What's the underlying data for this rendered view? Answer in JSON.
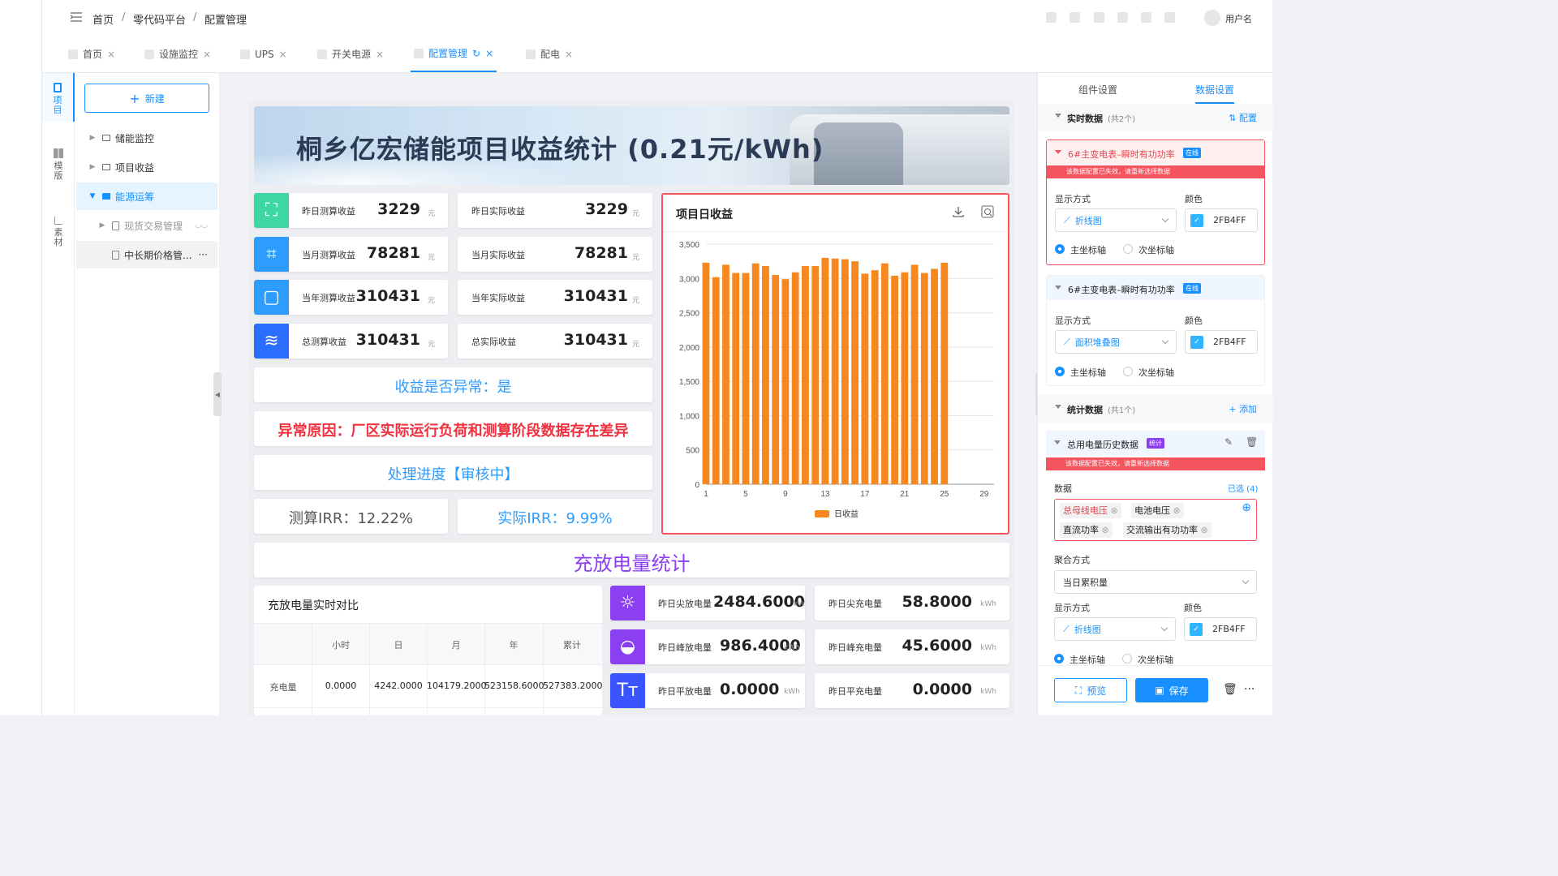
{
  "header": {
    "breadcrumb": [
      "首页",
      "零代码平台",
      "配置管理"
    ],
    "separator": "/",
    "user": "用户名"
  },
  "tabs": [
    {
      "label": "首页"
    },
    {
      "label": "设施监控"
    },
    {
      "label": "UPS"
    },
    {
      "label": "开关电源"
    },
    {
      "label": "配置管理",
      "active": true
    },
    {
      "label": "配电"
    }
  ],
  "rail": {
    "project": "项目",
    "template": "模版",
    "material": "素材"
  },
  "tree": {
    "new_label": "新建",
    "items": [
      "储能监控",
      "项目收益",
      "能源运筹",
      "现货交易管理",
      "中长期价格管..."
    ],
    "more": "···"
  },
  "banner": {
    "title": "桐乡亿宏储能项目收益统计 (0.21元/kWh)"
  },
  "kpis": [
    {
      "label": "昨日测算收益",
      "value": "3229",
      "unit": "元",
      "icon": "expand-icon",
      "color": "#3ed6a3"
    },
    {
      "label": "昨日实际收益",
      "value": "3229",
      "unit": "元"
    },
    {
      "label": "当月测算收益",
      "value": "78281",
      "unit": "元",
      "icon": "crop-icon",
      "color": "#2d9cff"
    },
    {
      "label": "当月实际收益",
      "value": "78281",
      "unit": "元"
    },
    {
      "label": "当年测算收益",
      "value": "310431",
      "unit": "元",
      "icon": "square-icon",
      "color": "#2d9cff"
    },
    {
      "label": "当年实际收益",
      "value": "310431",
      "unit": "元"
    },
    {
      "label": "总测算收益",
      "value": "310431",
      "unit": "元",
      "icon": "waves-icon",
      "color": "#2a6dff"
    },
    {
      "label": "总实际收益",
      "value": "310431",
      "unit": "元"
    }
  ],
  "status": {
    "abnormal": "收益是否异常：是",
    "reason": "异常原因：厂区实际运行负荷和测算阶段数据存在差异",
    "progress": "处理进度【审核中】",
    "irr_calc": "测算IRR：12.22%",
    "irr_actual": "实际IRR：9.99%"
  },
  "charge_title": "充放电量统计",
  "chart_data": {
    "type": "bar",
    "title": "项目日收益",
    "series": [
      {
        "name": "日收益",
        "values": [
          3230,
          3020,
          3200,
          3080,
          3080,
          3220,
          3180,
          3050,
          2990,
          3090,
          3180,
          3180,
          3300,
          3290,
          3280,
          3250,
          3070,
          3120,
          3220,
          3040,
          3090,
          3200,
          3080,
          3140,
          3230
        ]
      }
    ],
    "x": [
      1,
      2,
      3,
      4,
      5,
      6,
      7,
      8,
      9,
      10,
      11,
      12,
      13,
      14,
      15,
      16,
      17,
      18,
      19,
      20,
      21,
      22,
      23,
      24,
      25
    ],
    "xticks": [
      1,
      5,
      9,
      13,
      17,
      21,
      25,
      29
    ],
    "xlim": [
      1,
      30
    ],
    "ylim": [
      0,
      3500
    ],
    "yticks": [
      0,
      500,
      1000,
      1500,
      2000,
      2500,
      3000,
      3500
    ],
    "ytick_labels": [
      "0",
      "500",
      "1,000",
      "1,500",
      "2,000",
      "2,500",
      "3,000",
      "3,500"
    ],
    "color": "#f7881f",
    "legend": "bottom",
    "grid": true
  },
  "table": {
    "title": "充放电量实时对比",
    "headers": [
      "小时",
      "日",
      "月",
      "年",
      "累计"
    ],
    "rows": [
      {
        "label": "充电量",
        "values": [
          "0.0000",
          "4242.0000",
          "104179.2000",
          "523158.6000",
          "527383.2000"
        ]
      }
    ]
  },
  "energy": [
    {
      "label": "昨日尖放电量",
      "value": "2484.6000",
      "unit": "kWh",
      "icon": "sun-icon",
      "color": "#8a3ff1"
    },
    {
      "label": "昨日尖充电量",
      "value": "58.8000",
      "unit": "kWh"
    },
    {
      "label": "昨日峰放电量",
      "value": "986.4000",
      "unit": "kWh",
      "icon": "sunrise-icon",
      "color": "#8a3ff1"
    },
    {
      "label": "昨日峰充电量",
      "value": "45.6000",
      "unit": "kWh"
    },
    {
      "label": "昨日平放电量",
      "value": "0.0000",
      "unit": "kWh",
      "icon": "text-size-icon",
      "color": "#3a55ff"
    },
    {
      "label": "昨日平充电量",
      "value": "0.0000",
      "unit": "kWh"
    }
  ],
  "right_panel": {
    "tabs": [
      "组件设置",
      "数据设置"
    ],
    "realtime": {
      "title": "实时数据",
      "count": "(共2个)",
      "action": "配置"
    },
    "items": [
      {
        "title": "6#主变电表–瞬时有功功率",
        "badge": "在线",
        "warning": "该数据配置已失效，请重新选择数据",
        "display_label": "显示方式",
        "display": "折线图",
        "color_label": "颜色",
        "color": "2FB4FF",
        "axis_primary": "主坐标轴",
        "axis_secondary": "次坐标轴"
      },
      {
        "title": "6#主变电表–瞬时有功功率",
        "badge": "在线",
        "display_label": "显示方式",
        "display": "面积堆叠图",
        "color_label": "颜色",
        "color": "2FB4FF",
        "axis_primary": "主坐标轴",
        "axis_secondary": "次坐标轴"
      }
    ],
    "stats": {
      "title": "统计数据",
      "count": "(共1个)",
      "action": "添加"
    },
    "stat_item": {
      "title": "总用电量历史数据",
      "badge": "统计",
      "warning": "该数据配置已失效，请重新选择数据",
      "data_label": "数据",
      "selected": "已选 (4)",
      "chips": [
        "总母线电压",
        "电池电压",
        "直流功率",
        "交流输出有功功率"
      ],
      "agg_label": "聚合方式",
      "agg": "当日累积量",
      "display_label": "显示方式",
      "display": "折线图",
      "color_label": "颜色",
      "color": "2FB4FF",
      "axis_primary": "主坐标轴",
      "axis_secondary": "次坐标轴"
    },
    "preview": "预览",
    "save": "保存",
    "more": "···"
  }
}
